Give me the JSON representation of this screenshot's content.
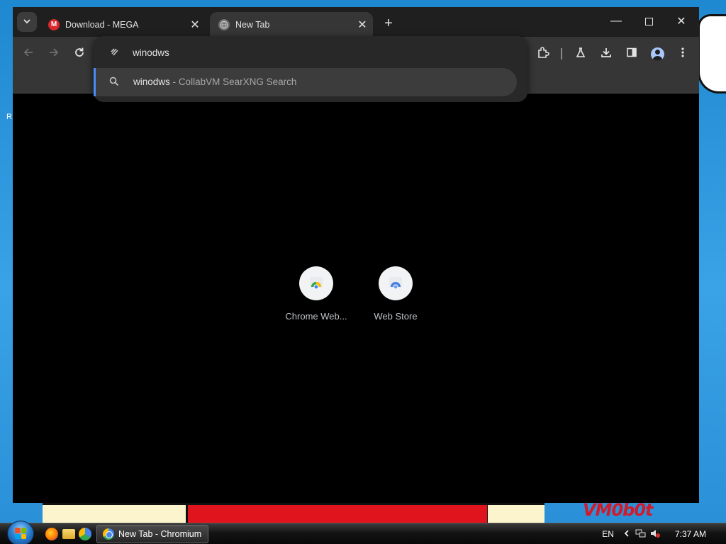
{
  "desktop": {
    "wallpaper_text": "VM0b0t",
    "edge_letter": "R"
  },
  "browser": {
    "tabs": [
      {
        "title": "Download - MEGA",
        "favicon": "mega-icon",
        "active": false
      },
      {
        "title": "New Tab",
        "favicon": "globe-icon",
        "active": true
      }
    ],
    "tab_close_glyph": "✕",
    "new_tab_glyph": "+",
    "window_controls": {
      "minimize": "—",
      "close": "✕"
    },
    "toolbar_icons": [
      "back-arrow-icon",
      "forward-arrow-icon",
      "reload-icon",
      "extensions-icon",
      "labs-flask-icon",
      "downloads-icon",
      "side-panel-icon",
      "profile-icon",
      "more-menu-icon"
    ],
    "omnibox": {
      "value": "winodws",
      "suggestion": {
        "query": "winodws",
        "separator": "-",
        "description": "CollabVM SearXNG Search"
      }
    },
    "shortcuts": [
      {
        "label": "Chrome Web..."
      },
      {
        "label": "Web Store"
      }
    ]
  },
  "taskbar": {
    "task_label": "New Tab - Chromium",
    "language": "EN",
    "clock": "7:37 AM"
  },
  "colors": {
    "window_bg": "#000000",
    "tabstrip_bg": "#1f1f1f",
    "toolbar_bg": "#363636",
    "omnibox_bg": "#282828",
    "suggestion_bg": "#3c3c3c",
    "suggestion_accent": "#4b8df8",
    "desktop_bg": "#1e88d0"
  }
}
